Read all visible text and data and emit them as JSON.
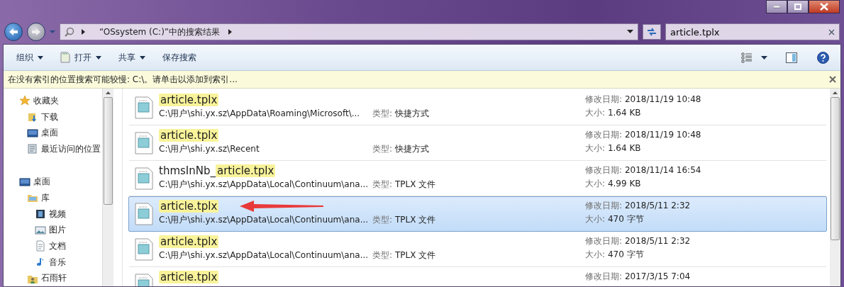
{
  "address_bar": {
    "location": "“OSsystem (C:)”中的搜索结果"
  },
  "search": {
    "value": "article.tplx"
  },
  "toolbar": {
    "items": [
      {
        "label": "组织",
        "dropdown": true,
        "icon": false
      },
      {
        "label": "打开",
        "dropdown": true,
        "icon": true
      },
      {
        "label": "共享",
        "dropdown": true,
        "icon": false
      },
      {
        "label": "保存搜索",
        "dropdown": false,
        "icon": false
      }
    ]
  },
  "info_bar": {
    "text": "在没有索引的位置搜索可能较慢: C:\\。请单击以添加到索引..."
  },
  "sidebar": {
    "groups": [
      {
        "label": "收藏夹",
        "kind": "star",
        "children": [
          {
            "label": "下载",
            "kind": "download"
          },
          {
            "label": "桌面",
            "kind": "desktop"
          },
          {
            "label": "最近访问的位置",
            "kind": "recent"
          }
        ]
      },
      {
        "label": "桌面",
        "kind": "desktop",
        "children": [
          {
            "label": "库",
            "kind": "library",
            "children": [
              {
                "label": "视频",
                "kind": "video"
              },
              {
                "label": "图片",
                "kind": "image"
              },
              {
                "label": "文档",
                "kind": "document"
              },
              {
                "label": "音乐",
                "kind": "music"
              }
            ]
          },
          {
            "label": "石雨轩",
            "kind": "user"
          }
        ]
      }
    ]
  },
  "results": [
    {
      "match": "article.tplx",
      "path": "C:\\用户\\shi.yx.sz\\AppData\\Roaming\\Microsoft\\...",
      "type_label": "类型:",
      "type": "快捷方式",
      "date_label": "修改日期:",
      "date": "2018/11/19 10:48",
      "size_label": "大小:",
      "size": "1.64 KB",
      "selected": false
    },
    {
      "match": "article.tplx",
      "path": "C:\\用户\\shi.yx.sz\\Recent",
      "type_label": "类型:",
      "type": "快捷方式",
      "date_label": "修改日期:",
      "date": "2018/11/19 10:48",
      "size_label": "大小:",
      "size": "1.64 KB",
      "selected": false
    },
    {
      "prefix": "thmsInNb_",
      "match": "article.tplx",
      "path": "C:\\用户\\shi.yx.sz\\AppData\\Local\\Continuum\\ana...",
      "type_label": "类型:",
      "type": "TPLX 文件",
      "date_label": "修改日期:",
      "date": "2018/11/14 16:54",
      "size_label": "大小:",
      "size": "4.99 KB",
      "selected": false
    },
    {
      "match": "article.tplx",
      "path": "C:\\用户\\shi.yx.sz\\AppData\\Local\\Continuum\\ana...",
      "type_label": "类型:",
      "type": "TPLX 文件",
      "date_label": "修改日期:",
      "date": "2018/5/11 2:32",
      "size_label": "大小:",
      "size": "470 字节",
      "selected": true
    },
    {
      "match": "article.tplx",
      "path": "C:\\用户\\shi.yx.sz\\AppData\\Local\\Continuum\\ana...",
      "type_label": "类型:",
      "type": "TPLX 文件",
      "date_label": "修改日期:",
      "date": "2018/5/11 2:32",
      "size_label": "大小:",
      "size": "470 字节",
      "selected": false
    },
    {
      "match": "article.tplx",
      "date_label": "修改日期:",
      "date": "2017/3/15 7:04",
      "selected": false
    }
  ]
}
